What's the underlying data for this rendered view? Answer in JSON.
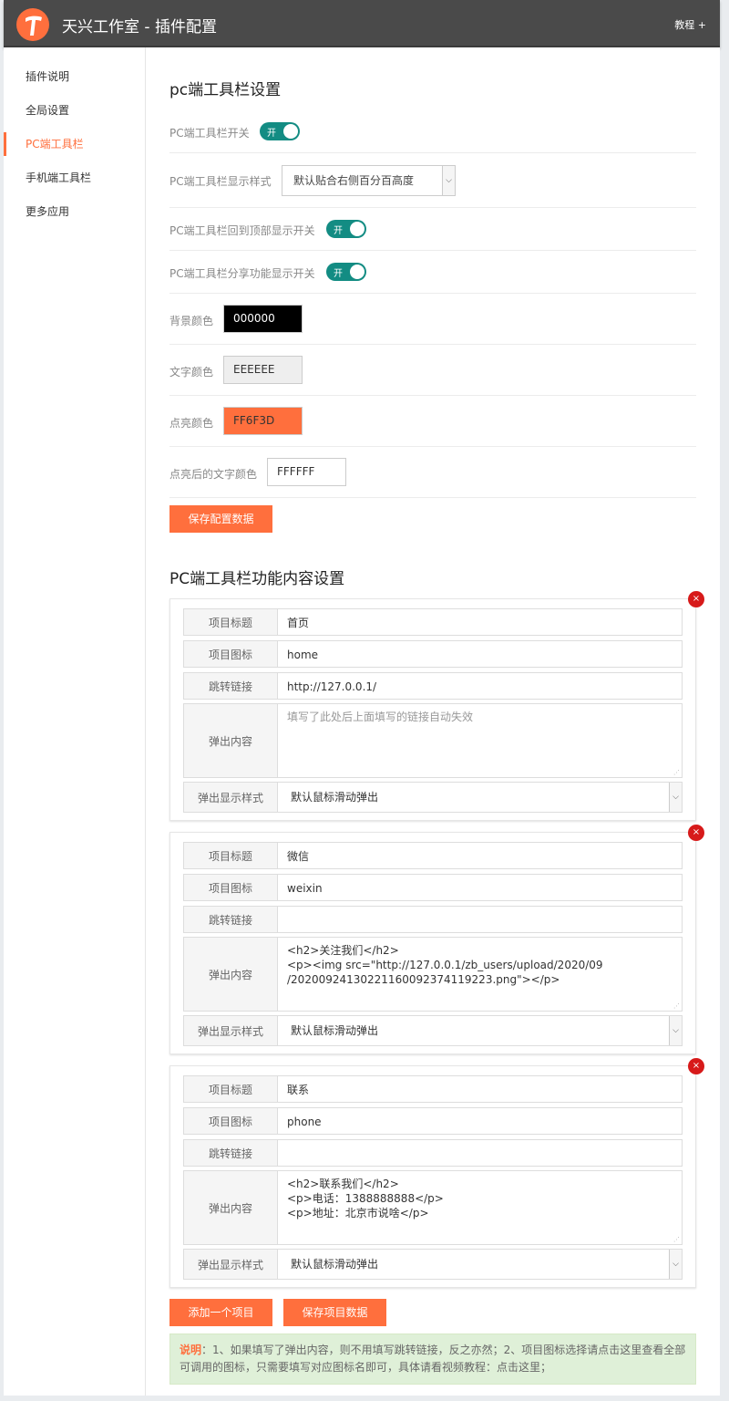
{
  "header": {
    "title": "天兴工作室 - 插件配置",
    "help": "教程 +"
  },
  "sidebar": {
    "items": [
      {
        "label": "插件说明"
      },
      {
        "label": "全局设置"
      },
      {
        "label": "PC端工具栏"
      },
      {
        "label": "手机端工具栏"
      },
      {
        "label": "更多应用"
      }
    ],
    "active_index": 2
  },
  "pc_settings": {
    "heading": "pc端工具栏设置",
    "toolbar_switch": {
      "label": "PC端工具栏开关",
      "state": "开"
    },
    "display_style": {
      "label": "PC端工具栏显示样式",
      "value": "默认贴合右侧百分百高度"
    },
    "back_to_top": {
      "label": "PC端工具栏回到顶部显示开关",
      "state": "开"
    },
    "share": {
      "label": "PC端工具栏分享功能显示开关",
      "state": "开"
    },
    "bg_color": {
      "label": "背景颜色",
      "value": "000000",
      "swatch": "#000000",
      "text": "#ffffff"
    },
    "text_color": {
      "label": "文字颜色",
      "value": "EEEEEE",
      "swatch": "#eeeeee",
      "text": "#333333"
    },
    "highlight_color": {
      "label": "点亮颜色",
      "value": "FF6F3D",
      "swatch": "#ff6f3d",
      "text": "#333333"
    },
    "highlight_text_color": {
      "label": "点亮后的文字颜色",
      "value": "FFFFFF",
      "swatch": "#ffffff",
      "text": "#333333"
    },
    "save_button": "保存配置数据"
  },
  "content_settings": {
    "heading": "PC端工具栏功能内容设置",
    "field_labels": {
      "title": "项目标题",
      "icon": "项目图标",
      "link": "跳转链接",
      "popup": "弹出内容",
      "popup_style": "弹出显示样式"
    },
    "popup_placeholder": "填写了此处后上面填写的链接自动失效",
    "delete_glyph": "×",
    "items": [
      {
        "title": "首页",
        "icon": "home",
        "link": "http://127.0.0.1/",
        "popup": "",
        "popup_style": "默认鼠标滑动弹出"
      },
      {
        "title": "微信",
        "icon": "weixin",
        "link": "",
        "popup": "<h2>关注我们</h2>\n<p><img src=\"http://127.0.0.1/zb_users/upload/2020/09\n/202009241302211600923741192​23.png\"></p>",
        "popup_style": "默认鼠标滑动弹出"
      },
      {
        "title": "联系",
        "icon": "phone",
        "link": "",
        "popup": "<h2>联系我们</h2>\n<p>电话：1388888888</p>\n<p>地址：北京市说啥</p>",
        "popup_style": "默认鼠标滑动弹出"
      }
    ],
    "add_button": "添加一个项目",
    "save_button": "保存项目数据"
  },
  "note": {
    "key": "说明",
    "text": "：1、如果填写了弹出内容，则不用填写跳转链接，反之亦然；2、项目图标选择请点击这里查看全部可调用的图标，只需要填写对应图标名即可，具体请看视频教程：点击这里；"
  },
  "colors": {
    "accent": "#ff6f3d",
    "toggle": "#138c83",
    "header": "#4a4a4a",
    "delete": "#d71a1a"
  }
}
